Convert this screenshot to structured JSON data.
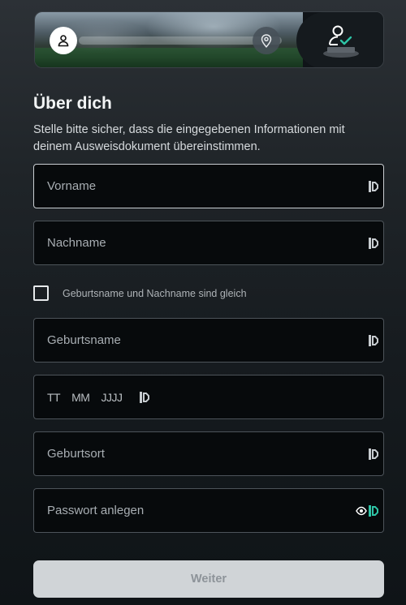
{
  "stepper": {
    "steps": [
      {
        "icon": "user-icon",
        "state": "current"
      },
      {
        "icon": "location-pin-icon",
        "state": "upcoming"
      },
      {
        "icon": "verified-user-icon",
        "state": "final"
      }
    ]
  },
  "heading": "Über dich",
  "subtitle": "Stelle bitte sicher, dass die eingegebenen Informationen mit deinem Ausweisdokument übereinstimmen.",
  "fields": {
    "first_name": {
      "placeholder": "Vorname",
      "value": ""
    },
    "last_name": {
      "placeholder": "Nachname",
      "value": ""
    },
    "birth_name": {
      "placeholder": "Geburtsname",
      "value": ""
    },
    "birth_date": {
      "day": "TT",
      "month": "MM",
      "year": "JJJJ"
    },
    "birth_place": {
      "placeholder": "Geburtsort",
      "value": ""
    },
    "password": {
      "placeholder": "Passwort anlegen",
      "value": ""
    }
  },
  "checkbox": {
    "label": "Geburtsname und Nachname sind gleich",
    "checked": false
  },
  "submit_label": "Weiter",
  "colors": {
    "accent": "#2ec4a6",
    "button_disabled": "#d0d4d7"
  }
}
